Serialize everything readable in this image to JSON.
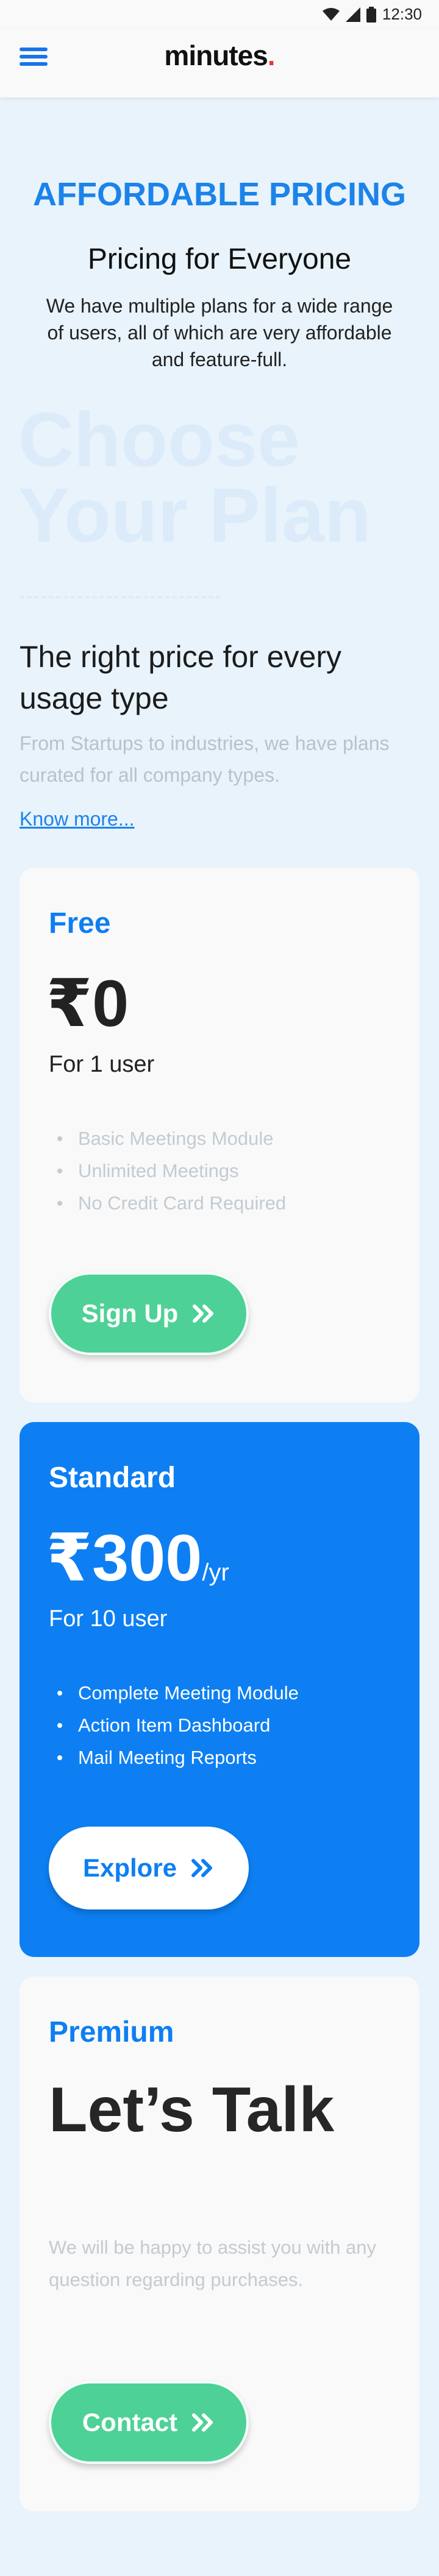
{
  "status_bar": {
    "time": "12:30"
  },
  "header": {
    "logo": "minutes",
    "logo_dot": "."
  },
  "hero": {
    "eyebrow": "AFFORDABLE PRICING",
    "title": "Pricing for Everyone",
    "description": "We have multiple plans for a wide range of users, all of which are very affordable and feature-full.",
    "watermark": "Choose Your Plan"
  },
  "section": {
    "title": "The right price for every usage type",
    "description": "From Startups to industries, we have plans curated for all company types.",
    "link": "Know more..."
  },
  "plans": [
    {
      "name": "Free",
      "price": "₹0",
      "users": "For 1 user",
      "features": [
        "Basic Meetings Module",
        "Unlimited Meetings",
        "No Credit Card Required"
      ],
      "button": "Sign Up"
    },
    {
      "name": "Standard",
      "price": "₹300",
      "price_unit": "/yr",
      "users": "For 10 user",
      "features": [
        "Complete Meeting Module",
        "Action Item Dashboard",
        "Mail Meeting Reports"
      ],
      "button": "Explore"
    },
    {
      "name": "Premium",
      "headline": "Let’s Talk",
      "description": "We will be happy to assist you with any question regarding purchases.",
      "button": "Contact"
    }
  ],
  "colors": {
    "accent": "#0d7ff2",
    "green_button": "#4ed196",
    "logo_dot": "#e53935"
  }
}
